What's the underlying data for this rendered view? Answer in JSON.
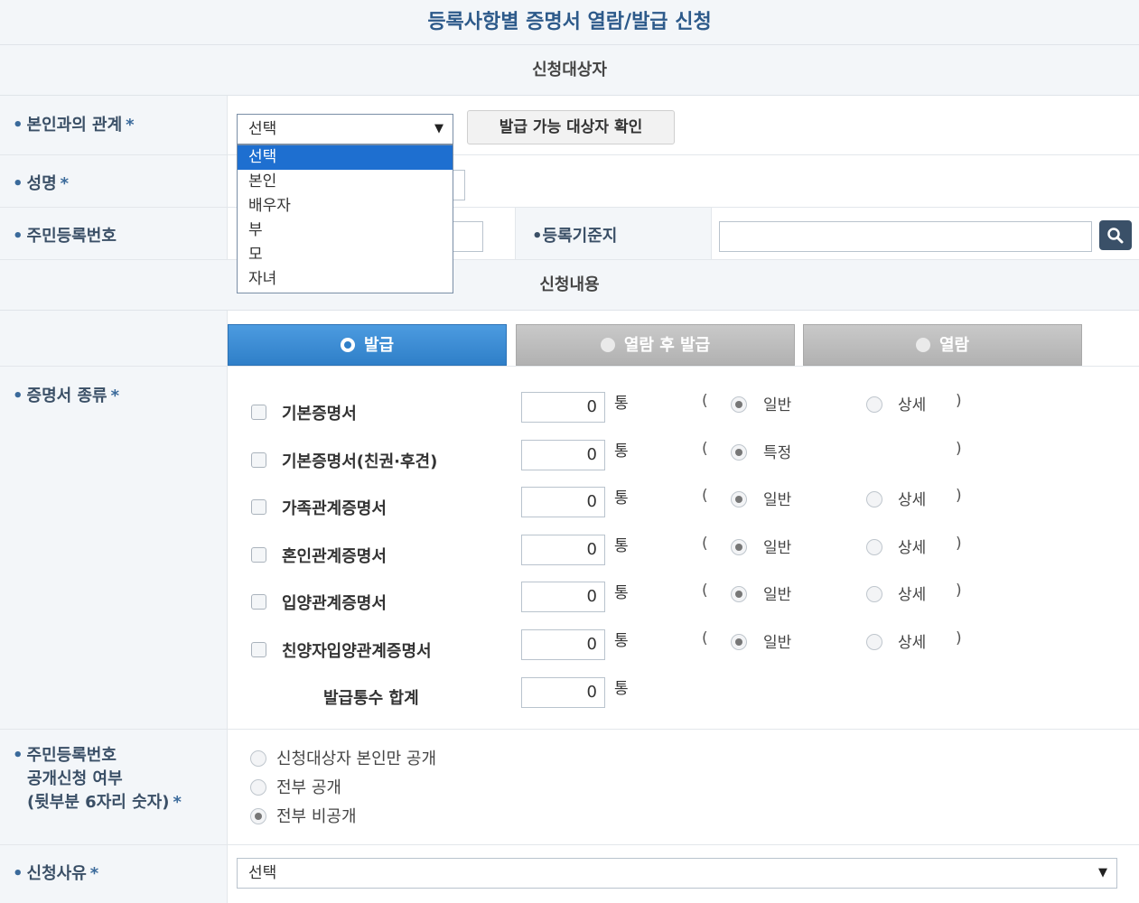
{
  "page_title": "등록사항별 증명서 열람/발급 신청",
  "sections": {
    "applicant": "신청대상자",
    "request": "신청내용"
  },
  "relation": {
    "label": "본인과의 관계",
    "required_mark": "*",
    "selected": "선택",
    "options": [
      "선택",
      "본인",
      "배우자",
      "부",
      "모",
      "자녀"
    ],
    "check_button": "발급 가능 대상자 확인"
  },
  "name": {
    "label": "성명",
    "required_mark": "*"
  },
  "resident_number": {
    "label": "주민등록번호"
  },
  "registration_base": {
    "label": "등록기준지"
  },
  "tabs": [
    {
      "label": "발급",
      "active": true
    },
    {
      "label": "열람 후 발급",
      "active": false
    },
    {
      "label": "열람",
      "active": false
    }
  ],
  "certificates": {
    "label": "증명서 종류",
    "required_mark": "*",
    "unit": "통",
    "paren_open": "(",
    "paren_close": ")",
    "items": [
      {
        "name": "기본증명서",
        "qty": "0",
        "option1": "일반",
        "option2": "상세"
      },
      {
        "name": "기본증명서(친권·후견)",
        "qty": "0",
        "option1": "특정",
        "option2": ""
      },
      {
        "name": "가족관계증명서",
        "qty": "0",
        "option1": "일반",
        "option2": "상세"
      },
      {
        "name": "혼인관계증명서",
        "qty": "0",
        "option1": "일반",
        "option2": "상세"
      },
      {
        "name": "입양관계증명서",
        "qty": "0",
        "option1": "일반",
        "option2": "상세"
      },
      {
        "name": "친양자입양관계증명서",
        "qty": "0",
        "option1": "일반",
        "option2": "상세"
      }
    ],
    "total_label": "발급통수 합계",
    "total_qty": "0"
  },
  "disclosure": {
    "label_line1": "주민등록번호",
    "label_line2": "공개신청 여부",
    "label_line3": "(뒷부분 6자리 숫자)",
    "required_mark": "*",
    "options": [
      "신청대상자 본인만 공개",
      "전부 공개",
      "전부 비공개"
    ],
    "selected_index": 2
  },
  "reason": {
    "label": "신청사유",
    "required_mark": "*",
    "selected": "선택"
  },
  "colors": {
    "title": "#2d5a8a",
    "tab_active": "#2f7fc8",
    "dropdown_highlight": "#1e6fd0",
    "search_button": "#3a5068"
  },
  "icons": {
    "search": "search-icon",
    "dropdown": "chevron-down-icon"
  }
}
